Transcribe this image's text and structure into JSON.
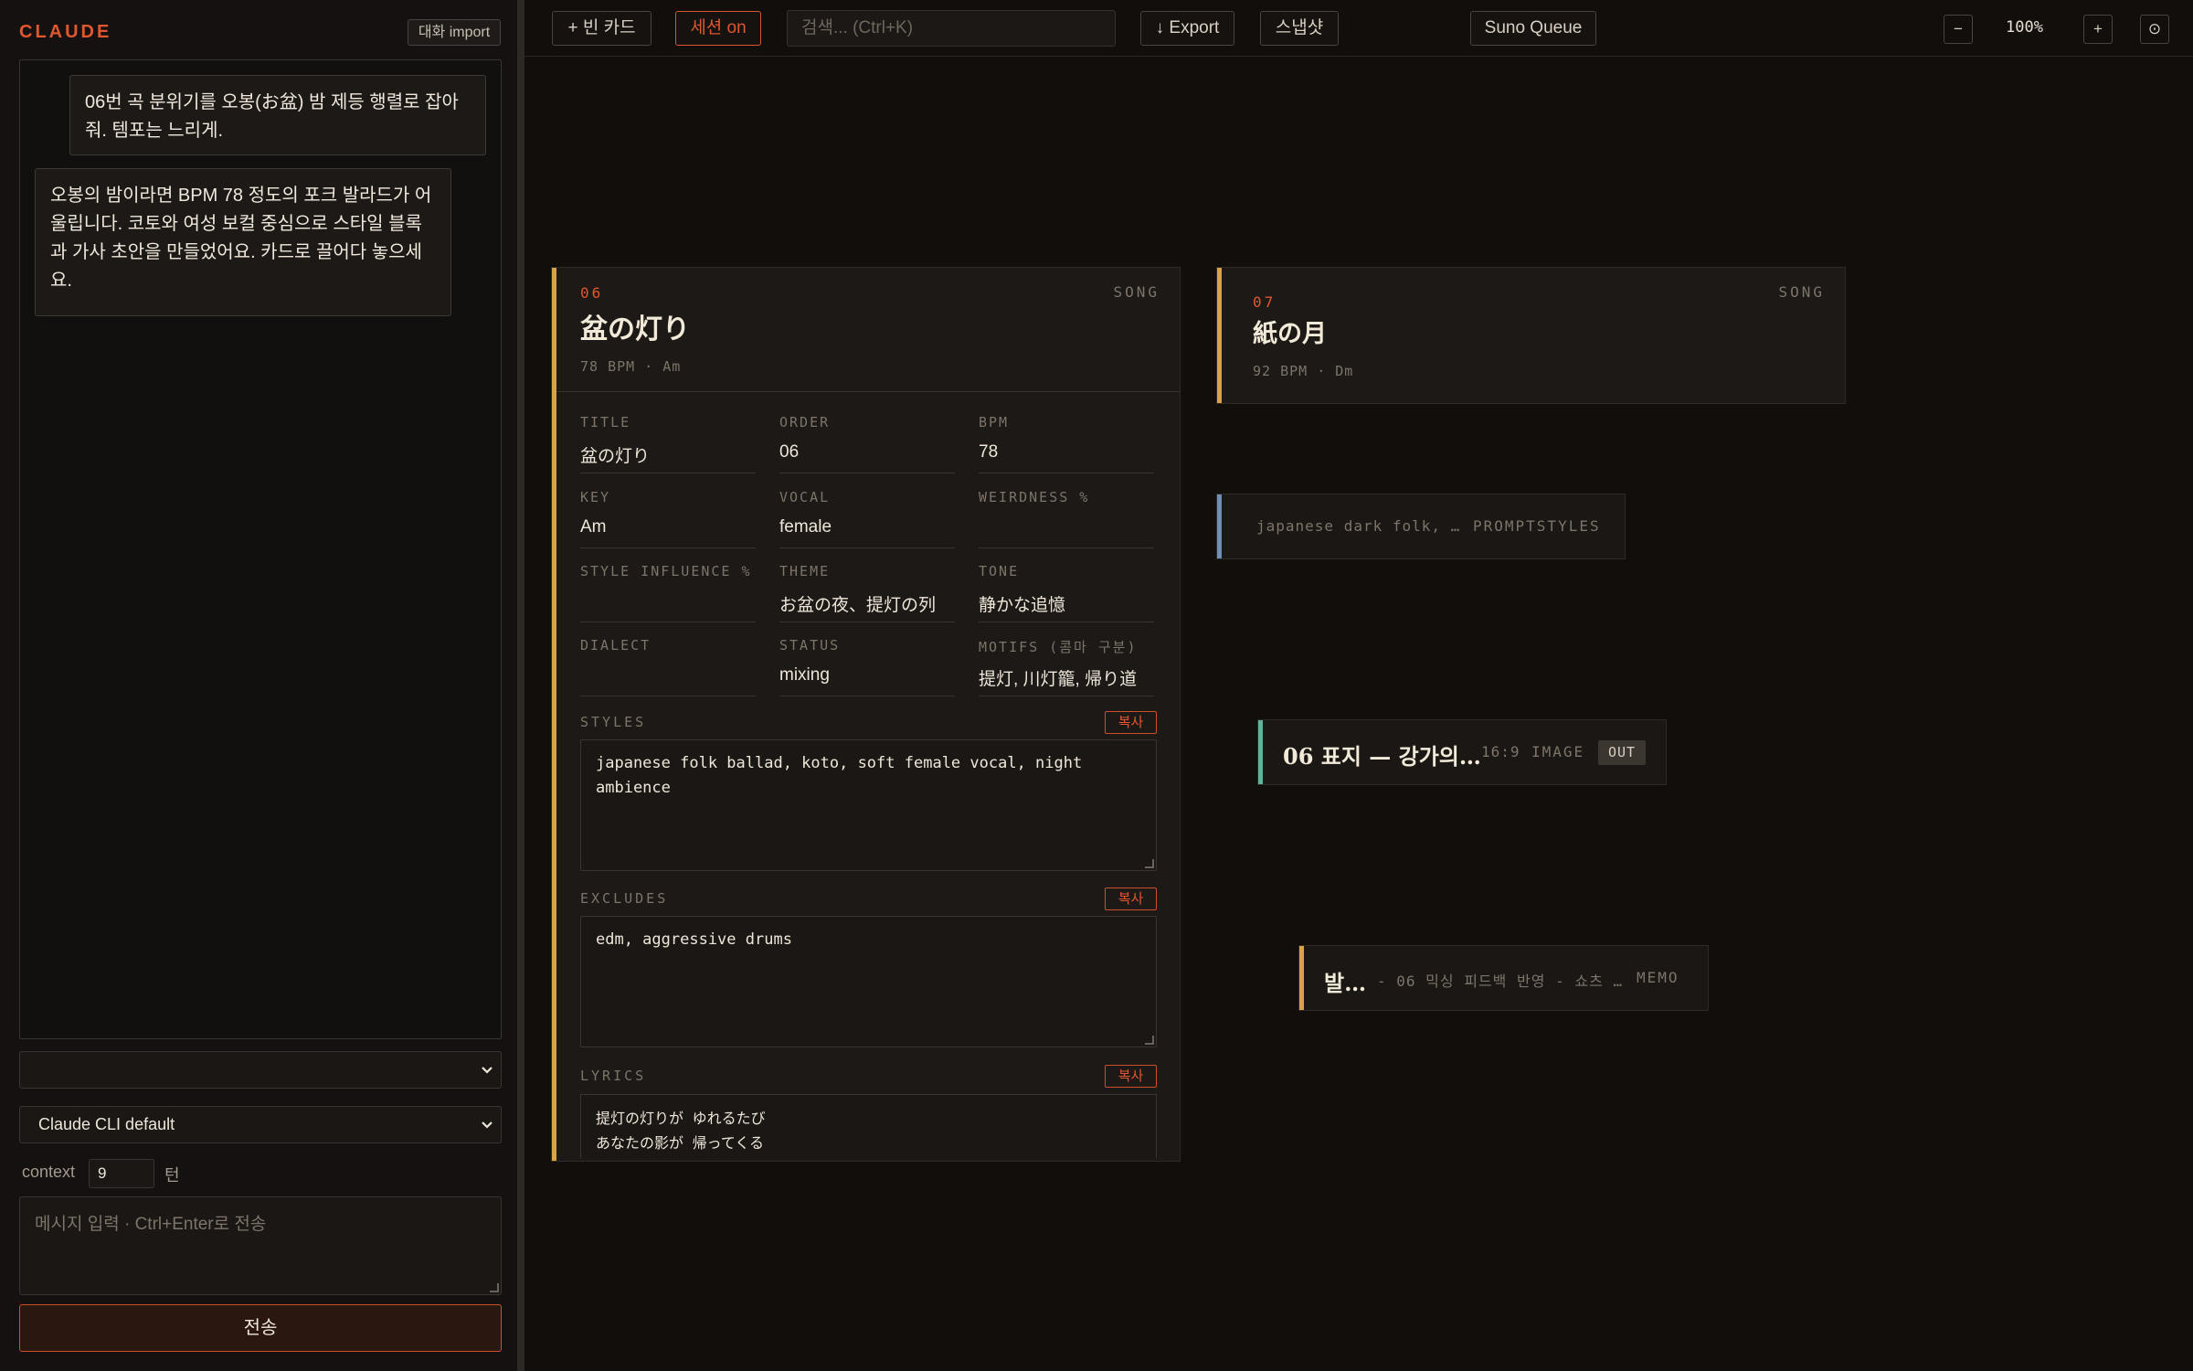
{
  "sidebar": {
    "brand": "CLAUDE",
    "import_label": "대화 import",
    "messages": [
      {
        "role": "user",
        "text": "06번 곡 분위기를 오봉(お盆) 밤 제등 행렬로 잡아줘. 템포는 느리게."
      },
      {
        "role": "assistant",
        "text": "오봉의 밤이라면 BPM 78 정도의 포크 발라드가 어울립니다. 코토와 여성 보컬 중심으로 스타일 블록과 가사 초안을 만들었어요. 카드로 끌어다 놓으세요."
      }
    ],
    "select_1_value": "",
    "model_select_value": "Claude CLI default",
    "context_label": "context",
    "context_value": "9",
    "context_unit": "턴",
    "input_placeholder": "메시지 입력 · Ctrl+Enter로 전송",
    "send_label": "전송"
  },
  "toolbar": {
    "new_card": "+ 빈 카드",
    "session": "세션 on",
    "search_placeholder": "검색... (Ctrl+K)",
    "export": "↓ Export",
    "snapshot": "스냅샷",
    "suno_queue": "Suno Queue",
    "zoom_out": "−",
    "zoom_level": "100%",
    "zoom_in": "+",
    "reset": "⊙"
  },
  "colors": {
    "accent": "#e0572f",
    "song_stripe": "#d9a34a",
    "prompt_stripe": "#6f8fb5",
    "image_stripe": "#5fb39a",
    "memo_stripe": "#d9a34a"
  },
  "cards": {
    "song06": {
      "number": "06",
      "kind": "SONG",
      "title": "盆の灯り",
      "meta": "78 BPM · Am",
      "fields": {
        "title_label": "TITLE",
        "title": "盆の灯り",
        "order_label": "ORDER",
        "order": "06",
        "bpm_label": "BPM",
        "bpm": "78",
        "key_label": "KEY",
        "key": "Am",
        "vocal_label": "VOCAL",
        "vocal": "female",
        "weirdness_label": "WEIRDNESS %",
        "weirdness": "",
        "style_influence_label": "STYLE INFLUENCE %",
        "style_influence": "",
        "theme_label": "THEME",
        "theme": "お盆の夜、提灯の列",
        "tone_label": "TONE",
        "tone": "静かな追憶",
        "dialect_label": "DIALECT",
        "dialect": "",
        "status_label": "STATUS",
        "status": "mixing",
        "motifs_label": "MOTIFS (콤마 구분)",
        "motifs": "提灯, 川灯籠, 帰り道"
      },
      "styles_label": "STYLES",
      "styles": "japanese folk ballad, koto, soft female vocal, night ambience",
      "excludes_label": "EXCLUDES",
      "excludes": "edm, aggressive drums",
      "lyrics_label": "LYRICS",
      "lyrics_line1": "提灯の灯りが ゆれるたび",
      "lyrics_line2": "あなたの影が 帰ってくる",
      "copy_label": "복사"
    },
    "song07": {
      "number": "07",
      "kind": "SONG",
      "title": "紙の月",
      "meta": "92 BPM · Dm"
    },
    "prompt": {
      "text": "japanese dark folk, …",
      "kind": "PROMPTSTYLES"
    },
    "image": {
      "title": "06 표지 — 강가의…",
      "ratio": "16:9",
      "kind": "IMAGE",
      "badge": "OUT"
    },
    "memo": {
      "title": "발…",
      "text": "- 06 믹싱 피드백 반영 - 쇼츠 …",
      "kind": "MEMO"
    }
  }
}
